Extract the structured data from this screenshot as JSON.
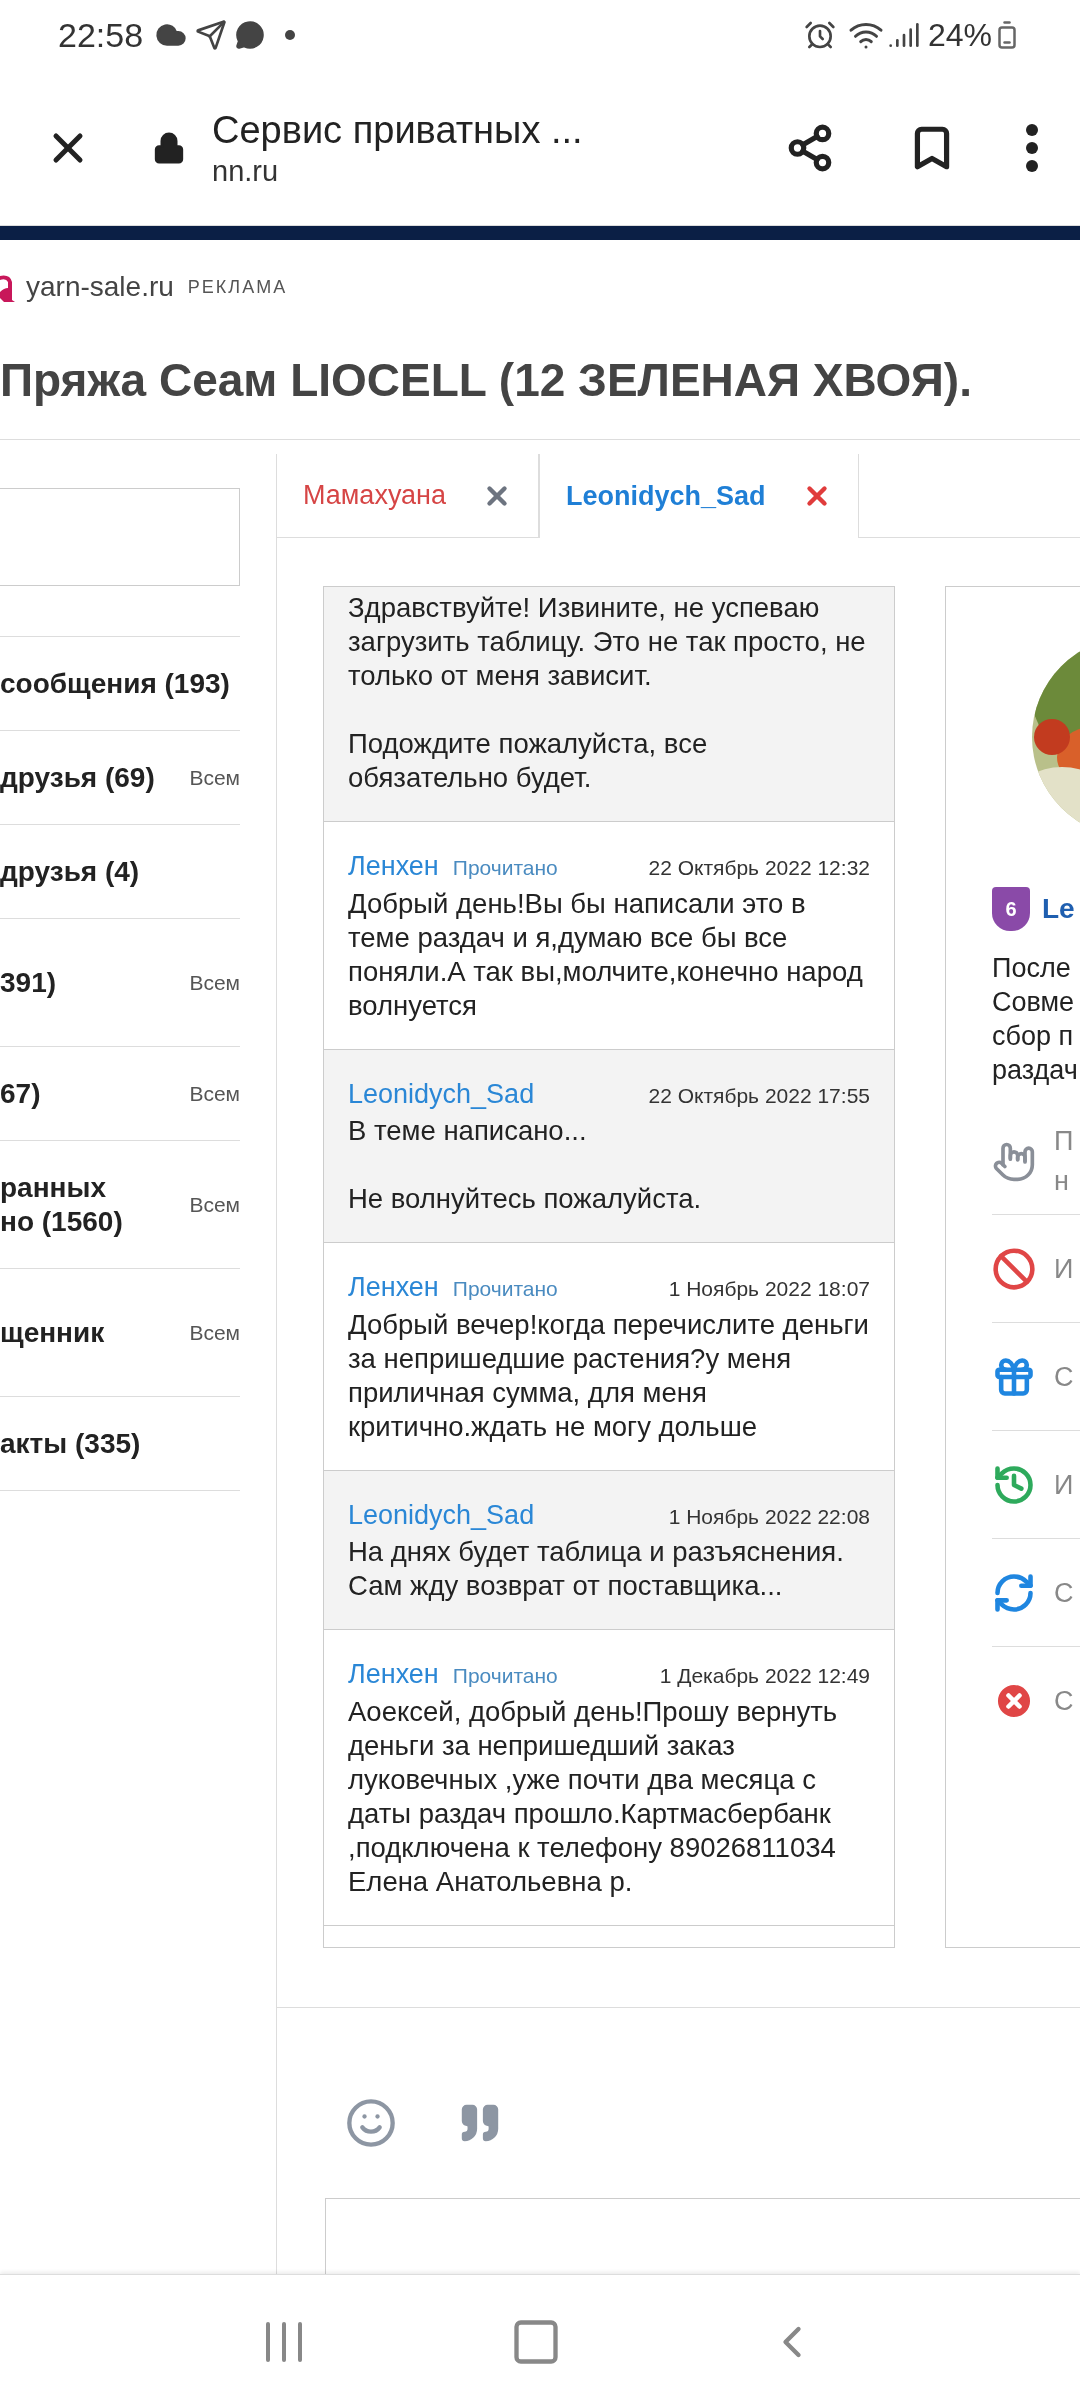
{
  "status_bar": {
    "time": "22:58",
    "battery": "24%"
  },
  "browser": {
    "title": "Сервис приватных ...",
    "url": "nn.ru"
  },
  "ad": {
    "site": "yarn-sale.ru",
    "label": "РЕКЛАМА"
  },
  "title": "Пряжа Сеам LIOCELL (12 ЗЕЛЕНАЯ ХВОЯ).",
  "sidebar": {
    "items": [
      {
        "lines": [
          "сообщения (193)"
        ]
      },
      {
        "lines": [
          "друзья (69)"
        ],
        "scope": "Всем"
      },
      {
        "lines": [
          "друзья (4)"
        ]
      },
      {
        "lines": [
          "391)"
        ],
        "scope": "Всем",
        "kind": "double"
      },
      {
        "lines": [
          "67)"
        ],
        "scope": "Всем"
      },
      {
        "lines": [
          "ранных",
          "но (1560)"
        ],
        "scope": "Всем",
        "kind": "double"
      },
      {
        "lines": [
          "щенник"
        ],
        "scope": "Всем",
        "kind": "double"
      },
      {
        "lines": [
          "акты (335)"
        ]
      }
    ]
  },
  "tabs": [
    {
      "label": "Мамахуана",
      "selected": false
    },
    {
      "label": "Leonidych_Sad",
      "selected": true
    }
  ],
  "messages": [
    {
      "own": true,
      "text": "Здравствуйте! Извините, не успеваю загрузить таблицу. Это не так просто, не только от меня зависит.\n\nПодождите пожалуйста, все обязательно будет."
    },
    {
      "own": false,
      "author": "Ленхен",
      "status": "Прочитано",
      "date": "22 Октябрь 2022 12:32",
      "text": "Добрый день!Вы бы написали это в теме раздач и я,думаю все бы все поняли.А так вы,молчите,конечно народ волнуется"
    },
    {
      "own": true,
      "author": "Leonidych_Sad",
      "date": "22 Октябрь 2022 17:55",
      "text": "В теме написано...\n\nНе волнуйтесь пожалуйста."
    },
    {
      "own": false,
      "author": "Ленхен",
      "status": "Прочитано",
      "date": "1 Ноябрь 2022 18:07",
      "text": "Добрый вечер!когда перечислите деньги за непришедшие растения?у меня приличная сумма, для меня критично.ждать не могу дольше"
    },
    {
      "own": true,
      "author": "Leonidych_Sad",
      "date": "1 Ноябрь 2022 22:08",
      "text": "На днях будет таблица и разъяснения. Сам жду возврат от поставщика..."
    },
    {
      "own": false,
      "author": "Ленхен",
      "status": "Прочитано",
      "date": "1 Декабрь 2022 12:49",
      "text": "Аоексей, добрый день!Прошу вернуть деньги за непришедший заказ луковечных ,уже почти два месяца с даты раздач прошло.Картмасбербанк ,подключена к телефону 89026811034 Елена Анатольевна р."
    }
  ],
  "profile": {
    "level": "6",
    "name": "Le",
    "about": [
      "После",
      "Совме",
      "сбор п",
      "раздач"
    ],
    "actions": [
      {
        "kind": "hands",
        "lines": [
          "П",
          "н"
        ]
      },
      {
        "kind": "ban",
        "lines": [
          "И"
        ]
      },
      {
        "kind": "gift",
        "lines": [
          "С"
        ]
      },
      {
        "kind": "history",
        "lines": [
          "И"
        ]
      },
      {
        "kind": "refresh",
        "lines": [
          "С"
        ]
      },
      {
        "kind": "remove",
        "lines": [
          "С"
        ]
      }
    ]
  }
}
